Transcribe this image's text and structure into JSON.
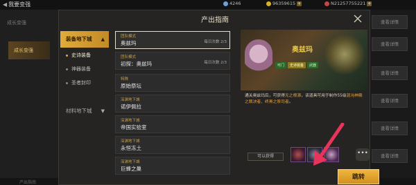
{
  "topbar": {
    "back_label": "我要变强",
    "resources": [
      "4246",
      "96359615",
      "N21257755221"
    ]
  },
  "background": {
    "left_items": [
      "成长变强",
      "成长变强"
    ],
    "right_buttons": [
      "查看详情",
      "查看详情",
      "查看详情",
      "查看详情",
      "查看详情",
      "查看详情"
    ],
    "bottom_text": "产出指南"
  },
  "modal": {
    "title": "产出指南",
    "categories": [
      {
        "label": "装备地下城",
        "expanded": true,
        "sub": [
          {
            "label": "史诗装备",
            "selected": true
          },
          {
            "label": "神器装备",
            "selected": false
          },
          {
            "label": "圣者封印",
            "selected": false
          }
        ]
      },
      {
        "label": "材料地下城",
        "expanded": false,
        "sub": []
      }
    ],
    "list": [
      {
        "type": "团队模式",
        "name": "奥兹玛",
        "count": "每日次数 2/3",
        "selected": true
      },
      {
        "type": "团队模式",
        "name": "初探：奥兹玛",
        "count": "每日次数 2/3",
        "selected": false
      },
      {
        "type": "特殊",
        "name": "原始祭坛",
        "count": "",
        "selected": false
      },
      {
        "type": "深渊地下城",
        "name": "诺伊佩拉",
        "count": "",
        "selected": false
      },
      {
        "type": "深渊地下城",
        "name": "帝国实验室",
        "count": "",
        "selected": false
      },
      {
        "type": "深渊地下城",
        "name": "永恒冻土",
        "count": "",
        "selected": false
      },
      {
        "type": "深渊地下城",
        "name": "巨蜂之巢",
        "count": "",
        "selected": false
      }
    ],
    "detail": {
      "name": "奥兹玛",
      "tags": [
        "可门",
        "史诗装备",
        "武器"
      ],
      "desc_prefix": "通关奥兹玛后，可获得",
      "desc_hl1": "无之根源",
      "desc_mid": "，该道具可用于制作55级",
      "desc_hl2": "混沌神殿之裁决者、终焉之祭司者",
      "desc_suffix": "。",
      "obtain_label": "可以获得",
      "more_label": "•••",
      "jump_label": "跳转"
    }
  },
  "colors": {
    "accent": "#e0ac3c",
    "arrow": "#e8345a"
  }
}
